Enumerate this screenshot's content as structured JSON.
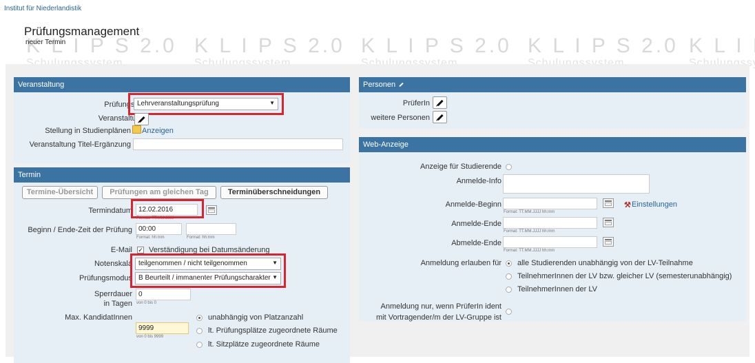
{
  "breadcrumb": "Institut für Niederlandistik",
  "page": {
    "title": "Prüfungsmanagement",
    "subtitle": "neuer Termin"
  },
  "watermark": {
    "text": "K L I P S 2.0",
    "sub": "Schulungssystem"
  },
  "veranstaltung": {
    "header": "Veranstaltung",
    "pruefungstyp_label": "Prüfungstyp",
    "pruefungstyp_value": "Lehrveranstaltungsprüfung",
    "veranstaltung_label": "Veranstaltung",
    "stellung_label": "Stellung in Studienplänen",
    "anzeigen_link": "Anzeigen",
    "titel_label": "Veranstaltung Titel-Ergänzung"
  },
  "termin": {
    "header": "Termin",
    "buttons": [
      "Termine-Übersicht",
      "Prüfungen am gleichen Tag",
      "Terminüberschneidungen"
    ],
    "termindatum_label": "Termindatum",
    "termindatum_value": "12.02.2016",
    "termindatum_hint": "Format: TT.MM.JJJJ",
    "beginn_ende_label": "Beginn / Ende-Zeit der Prüfung",
    "beginn_value": "00:00",
    "time_hint": "Format: hh:mm",
    "email_label": "E-Mail",
    "email_text": "Verständigung bei Datumsänderung",
    "notenskala_label": "Notenskala",
    "notenskala_value": "teilgenommen / nicht teilgenommen",
    "pruefungsmodus_label": "Prüfungsmodus",
    "pruefungsmodus_value": "B Beurteilt / immanenter Prüfungscharakter",
    "sperrdauer_label": "Sperrdauer",
    "sperrdauer_label2": "in Tagen",
    "sperrdauer_value": "0",
    "sperrdauer_hint": "von 0 bis 0",
    "max_kand_label": "Max. KandidatInnen",
    "max_kand_value": "9999",
    "max_kand_hint": "von 0 bis 9999",
    "radio_options": [
      "unabhängig von Platzanzahl",
      "lt. Prüfungsplätze zugeordnete Räume",
      "lt. Sitzplätze zugeordnete Räume"
    ]
  },
  "personen": {
    "header": "Personen",
    "pruefer_label": "PrüferIn",
    "weitere_label": "weitere Personen"
  },
  "web": {
    "header": "Web-Anzeige",
    "anzeige_label": "Anzeige für Studierende",
    "info_label": "Anmelde-Info",
    "beginn_label": "Anmelde-Beginn",
    "ende_label": "Anmelde-Ende",
    "abmelde_label": "Abmelde-Ende",
    "datetime_hint": "Format: TT.MM.JJJJ hh:mm",
    "einstellungen_link": "Einstellungen",
    "erlauben_label": "Anmeldung erlauben für",
    "erlauben_options": [
      "alle Studierenden unabhängig von der LV-Teilnahme",
      "TeilnehmerInnen der LV bzw. gleicher LV (semesterunabhängig)",
      "TeilnehmerInnen der LV"
    ],
    "ident_label1": "Anmeldung nur, wenn PrüferIn ident",
    "ident_label2": "mit Vortragender/m der LV-Gruppe ist"
  }
}
